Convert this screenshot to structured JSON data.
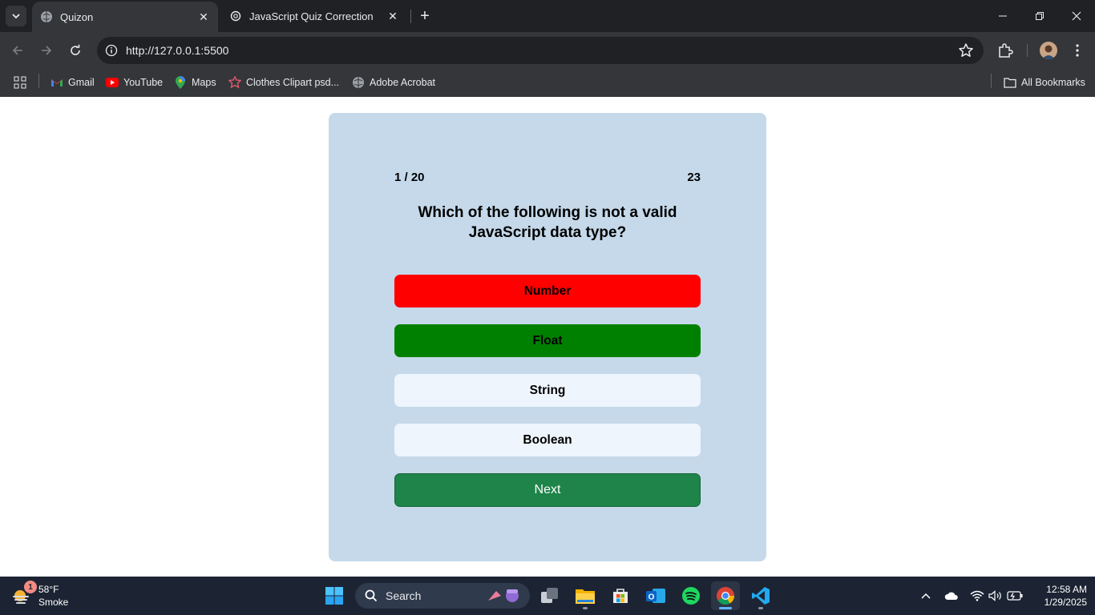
{
  "browser": {
    "tabs": [
      {
        "title": "Quizon",
        "active": true
      },
      {
        "title": "JavaScript Quiz Correction",
        "active": false
      }
    ],
    "url": "http://127.0.0.1:5500",
    "bookmarks": [
      {
        "label": "Gmail",
        "icon": "gmail-icon"
      },
      {
        "label": "YouTube",
        "icon": "youtube-icon"
      },
      {
        "label": "Maps",
        "icon": "maps-icon"
      },
      {
        "label": "Clothes Clipart psd...",
        "icon": "clipart-icon"
      },
      {
        "label": "Adobe Acrobat",
        "icon": "globe-icon"
      }
    ],
    "all_bookmarks_label": "All Bookmarks"
  },
  "quiz": {
    "progress": "1 / 20",
    "score": "23",
    "question": "Which of the following is not a valid JavaScript data type?",
    "options": [
      {
        "label": "Number",
        "state": "incorrect",
        "color": "#ff0000"
      },
      {
        "label": "Float",
        "state": "correct",
        "color": "#008000"
      },
      {
        "label": "String",
        "state": "neutral",
        "color": "#eef5fd"
      },
      {
        "label": "Boolean",
        "state": "neutral",
        "color": "#eef5fd"
      }
    ],
    "next_label": "Next",
    "card_color": "#c5d9ea",
    "next_color": "#1e8449"
  },
  "taskbar": {
    "weather": {
      "temp": "58°F",
      "condition": "Smoke",
      "badge": "1"
    },
    "search_placeholder": "Search",
    "clock": {
      "time": "12:58 AM",
      "date": "1/29/2025"
    }
  }
}
